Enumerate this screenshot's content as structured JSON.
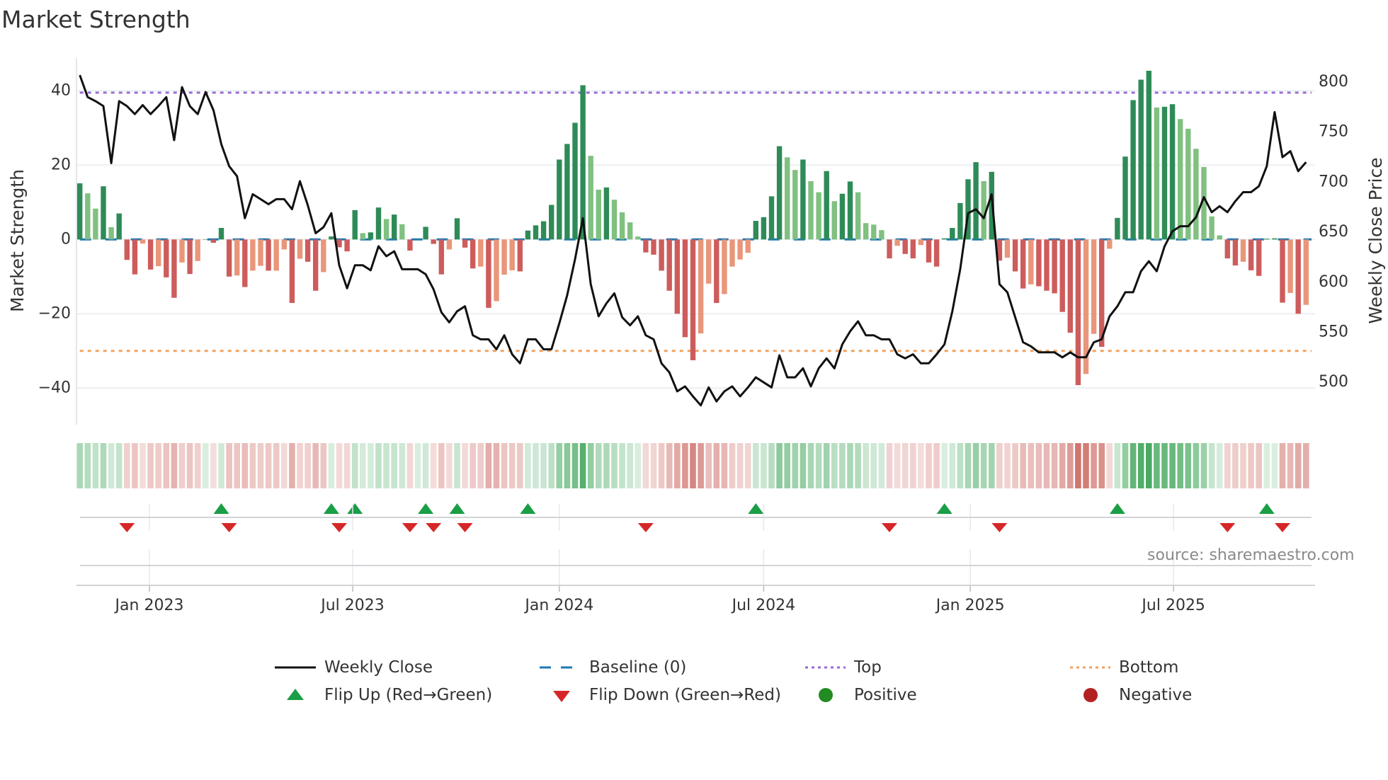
{
  "chart_data": {
    "type": "bar+line",
    "title": "Market Strength",
    "ylabel_left": "Market Strength",
    "ylabel_right": "Weekly Close Price",
    "ylim_left": [
      -46,
      49
    ],
    "ylim_right": [
      450,
      825
    ],
    "yticks_left": [
      {
        "v": 40,
        "label": "40"
      },
      {
        "v": 20,
        "label": "20"
      },
      {
        "v": 0,
        "label": "0"
      },
      {
        "v": -20,
        "label": "−20"
      },
      {
        "v": -40,
        "label": "−40"
      }
    ],
    "yticks_right": [
      {
        "v": 800,
        "label": "800"
      },
      {
        "v": 750,
        "label": "750"
      },
      {
        "v": 700,
        "label": "700"
      },
      {
        "v": 650,
        "label": "650"
      },
      {
        "v": 600,
        "label": "600"
      },
      {
        "v": 550,
        "label": "550"
      },
      {
        "v": 500,
        "label": "500"
      }
    ],
    "xticks": [
      {
        "date": "2023-01-01",
        "label": "Jan 2023"
      },
      {
        "date": "2023-07-01",
        "label": "Jul 2023"
      },
      {
        "date": "2024-01-01",
        "label": "Jan 2024"
      },
      {
        "date": "2024-07-01",
        "label": "Jul 2024"
      },
      {
        "date": "2025-01-01",
        "label": "Jan 2025"
      },
      {
        "date": "2025-07-01",
        "label": "Jul 2025"
      }
    ],
    "x_start": "2022-10-31",
    "x_step_days": 7,
    "grid": true,
    "top_level": 39.5,
    "bottom_level": -30,
    "baseline": 0,
    "strength": [
      15.1,
      12.4,
      8.3,
      14.3,
      3.3,
      7.0,
      -5.5,
      -9.4,
      -1.1,
      -8.1,
      -7.2,
      -10.2,
      -15.7,
      -6.2,
      -9.3,
      -5.8,
      0,
      -0.9,
      3.1,
      -10.0,
      -9.7,
      -12.8,
      -8.4,
      -7.1,
      -8.4,
      -8.4,
      -2.7,
      -17.1,
      -5.2,
      -6.0,
      -13.8,
      -8.8,
      0.8,
      -2.1,
      -3.2,
      7.9,
      1.7,
      1.9,
      8.6,
      5.5,
      6.7,
      4.1,
      -3.0,
      0,
      3.4,
      -1.2,
      -9.4,
      -2.7,
      5.7,
      -2.2,
      -7.8,
      -7.3,
      -18.4,
      -16.6,
      -9.5,
      -8.3,
      -8.6,
      2.4,
      3.8,
      4.9,
      9.3,
      21.5,
      25.7,
      31.4,
      41.5,
      22.5,
      13.4,
      14.0,
      10.7,
      7.3,
      4.6,
      0.8,
      -3.5,
      -4.1,
      -8.4,
      -13.8,
      -20.0,
      -26.3,
      -32.5,
      -25.3,
      -11.9,
      -17.1,
      -14.7,
      -7.3,
      -5.4,
      -3.6,
      5.0,
      6.0,
      11.6,
      25.1,
      22.1,
      18.7,
      21.5,
      15.7,
      12.7,
      18.4,
      10.3,
      12.3,
      15.6,
      12.7,
      4.4,
      4.0,
      2.5,
      -5.1,
      -1.7,
      -3.9,
      -5.1,
      -1.5,
      -6.2,
      -7.3,
      0.3,
      3.1,
      9.8,
      16.2,
      20.8,
      15.7,
      18.2,
      -5.7,
      -4.9,
      -8.6,
      -13.2,
      -12.1,
      -12.6,
      -13.8,
      -14.5,
      -19.5,
      -25.1,
      -39.2,
      -36.2,
      -25.4,
      -28.9,
      -2.5,
      5.8,
      22.3,
      37.5,
      43.0,
      45.4,
      35.5,
      35.7,
      36.4,
      32.4,
      29.8,
      24.4,
      19.5,
      6.2,
      1.1,
      -5.1,
      -7.0,
      -6.0,
      -8.3,
      -9.8,
      0.2,
      0.3,
      -17.0,
      -14.4,
      -20.0,
      -17.6
    ],
    "weekly_close": [
      807,
      785,
      781,
      776,
      719,
      781,
      776,
      768,
      777,
      768,
      776,
      785,
      742,
      795,
      776,
      768,
      790,
      772,
      738,
      716,
      706,
      664,
      688,
      683,
      678,
      683,
      683,
      673,
      701,
      677,
      649,
      655,
      669,
      617,
      594,
      617,
      617,
      612,
      636,
      626,
      631,
      613,
      613,
      613,
      608,
      593,
      570,
      560,
      571,
      576,
      547,
      543,
      543,
      533,
      547,
      528,
      519,
      543,
      543,
      533,
      533,
      559,
      587,
      623,
      664,
      598,
      566,
      579,
      589,
      565,
      557,
      566,
      547,
      543,
      519,
      510,
      491,
      496,
      486,
      477,
      495,
      481,
      491,
      496,
      486,
      495,
      505,
      500,
      495,
      527,
      505,
      505,
      514,
      496,
      514,
      524,
      514,
      538,
      551,
      561,
      547,
      547,
      543,
      543,
      528,
      524,
      528,
      519,
      519,
      528,
      538,
      571,
      613,
      669,
      673,
      664,
      688,
      598,
      590,
      565,
      540,
      536,
      530,
      530,
      530,
      525,
      530,
      525,
      525,
      540,
      543,
      566,
      576,
      590,
      590,
      611,
      621,
      611,
      636,
      651,
      656,
      656,
      665,
      685,
      670,
      676,
      670,
      681,
      690,
      690,
      696,
      716,
      770,
      725,
      731,
      711,
      720
    ],
    "flip_up_weeks": [
      18,
      32,
      35,
      44,
      48,
      57,
      86,
      110,
      132,
      151
    ],
    "flip_down_weeks": [
      6,
      19,
      33,
      42,
      45,
      49,
      72,
      103,
      117,
      146,
      153
    ],
    "colors": {
      "rising_positive": "#2e8b57",
      "falling_positive": "#80c080",
      "falling_negative": "#cd5c5c",
      "rising_negative": "#e9967a",
      "baseline": "#1f77b4",
      "top": "#9b6ad6",
      "bottom": "#f4a25e",
      "close": "#111111",
      "flip_up": "#1a9e46",
      "flip_down": "#d62728",
      "positive": "#228b22",
      "negative": "#b22222"
    },
    "legend": {
      "placement": "bottom",
      "items": [
        {
          "label": "Weekly Close"
        },
        {
          "label": "Baseline (0)"
        },
        {
          "label": "Top"
        },
        {
          "label": "Bottom"
        },
        {
          "label": "Flip Up (Red→Green)"
        },
        {
          "label": "Flip Down (Green→Red)"
        },
        {
          "label": "Positive"
        },
        {
          "label": "Negative"
        }
      ]
    }
  },
  "source": "source: sharemaestro.com"
}
